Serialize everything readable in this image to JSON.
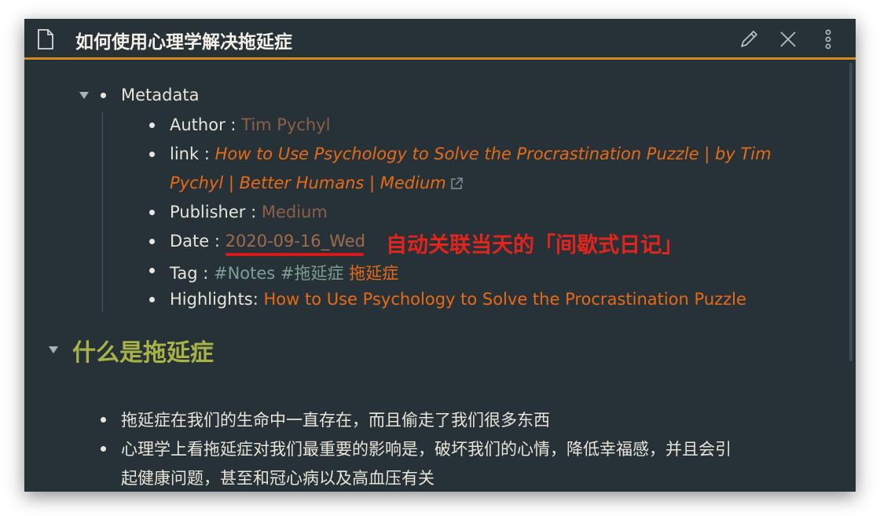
{
  "window": {
    "title": "如何使用心理学解决拖延症",
    "icons": {
      "file": "file-icon",
      "edit": "pencil-icon",
      "close": "close-icon",
      "more": "more-vertical-icon"
    }
  },
  "metadata": {
    "label": "Metadata",
    "author": {
      "key": "Author : ",
      "value": "Tim Pychyl"
    },
    "link": {
      "key": "link : ",
      "value_line1": "How to Use Psychology to Solve the Procrastination Puzzle | by Tim",
      "value_line2": "Pychyl | Better Humans | Medium",
      "icon": "external-link-icon"
    },
    "publisher": {
      "key": "Publisher : ",
      "value": "Medium"
    },
    "date": {
      "key": "Date : ",
      "value": "2020-09-16_Wed"
    },
    "tag": {
      "key": "Tag : ",
      "tag1": "#Notes",
      "tag2": "#拖延症",
      "tag3": "拖延症"
    },
    "highlights": {
      "key": "Highlights: ",
      "value": "How to Use Psychology to Solve the Procrastination Puzzle"
    }
  },
  "annotation": "自动关联当天的「间歇式日记」",
  "section": {
    "heading": "什么是拖延症",
    "item1": "拖延症在我们的生命中一直存在，而且偷走了我们很多东西",
    "item2_line1": "心理学上看拖延症对我们最重要的影响是，破坏我们的心情，降低幸福感，并且会引",
    "item2_line2": "起健康问题，甚至和冠心病以及高血压有关"
  },
  "colors": {
    "accent": "#d38a1a",
    "background": "#263237",
    "link": "#e86a17",
    "annotation": "#e2241d",
    "heading": "#a7b347"
  }
}
